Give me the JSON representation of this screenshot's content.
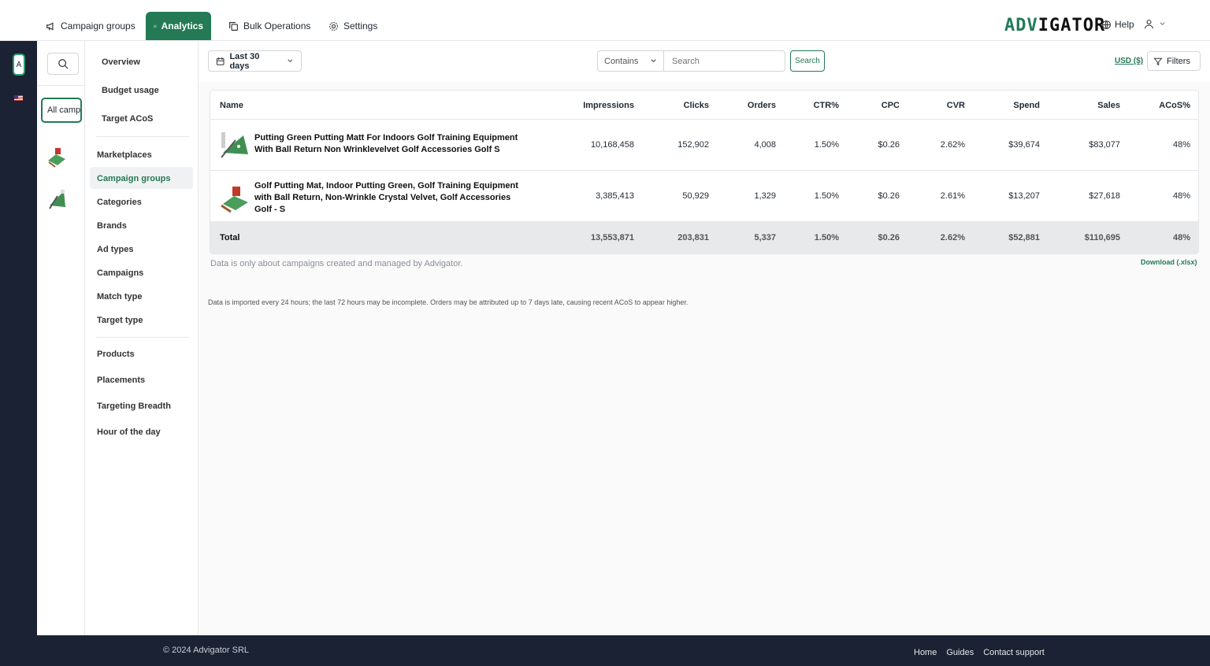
{
  "nav": {
    "tabs": [
      {
        "label": "Campaign groups",
        "icon": "megaphone-icon"
      },
      {
        "label": "Analytics",
        "icon": "chart-icon"
      },
      {
        "label": "Bulk Operations",
        "icon": "copy-icon"
      },
      {
        "label": "Settings",
        "icon": "gear-icon"
      }
    ],
    "logo": {
      "part1": "ADV",
      "part2": "IGATOR"
    },
    "help_label": "Help"
  },
  "rail": {
    "account_letter": "A"
  },
  "groups": {
    "all_label": "All campaigns"
  },
  "menu": {
    "items": [
      "Overview",
      "Budget usage",
      "Target ACoS",
      "Marketplaces",
      "Campaign groups",
      "Categories",
      "Brands",
      "Ad types",
      "Campaigns",
      "Match type",
      "Target type",
      "Products",
      "Placements",
      "Targeting Breadth",
      "Hour of the day"
    ],
    "active": "Campaign groups"
  },
  "toolbar": {
    "date_range": "Last 30 days",
    "match_mode": "Contains",
    "search_placeholder": "Search",
    "search_button": "Search",
    "currency": "USD ($)",
    "filters_label": "Filters"
  },
  "table": {
    "columns": [
      "Name",
      "Impressions",
      "Clicks",
      "Orders",
      "CTR%",
      "CPC",
      "CVR",
      "Spend",
      "Sales",
      "ACoS%"
    ],
    "rows": [
      {
        "name": "Putting Green Putting Matt For Indoors Golf Training Equipment With Ball Return Non Wrinklevelvet Golf Accessories Golf S",
        "impressions": "10,168,458",
        "clicks": "152,902",
        "orders": "4,008",
        "ctr": "1.50%",
        "cpc": "$0.26",
        "cvr": "2.62%",
        "spend": "$39,674",
        "sales": "$83,077",
        "acos": "48%"
      },
      {
        "name": "Golf Putting Mat, Indoor Putting Green, Golf Training Equipment with Ball Return, Non-Wrinkle Crystal Velvet, Golf Accessories Golf - S",
        "impressions": "3,385,413",
        "clicks": "50,929",
        "orders": "1,329",
        "ctr": "1.50%",
        "cpc": "$0.26",
        "cvr": "2.61%",
        "spend": "$13,207",
        "sales": "$27,618",
        "acos": "48%"
      }
    ],
    "total": {
      "label": "Total",
      "impressions": "13,553,871",
      "clicks": "203,831",
      "orders": "5,337",
      "ctr": "1.50%",
      "cpc": "$0.26",
      "cvr": "2.62%",
      "spend": "$52,881",
      "sales": "$110,695",
      "acos": "48%"
    }
  },
  "notes": {
    "scope": "Data is only about campaigns created and managed by Advigator.",
    "download": "Download (.xlsx)",
    "import": "Data is imported every 24 hours; the last 72 hours may be incomplete. Orders may be attributed up to 7 days late, causing recent ACoS to appear higher."
  },
  "footer": {
    "copyright": "© 2024 Advigator SRL",
    "links": [
      "Home",
      "Guides",
      "Contact support"
    ]
  },
  "colors": {
    "accent": "#237a55",
    "sidebar_dark": "#1a2233"
  }
}
